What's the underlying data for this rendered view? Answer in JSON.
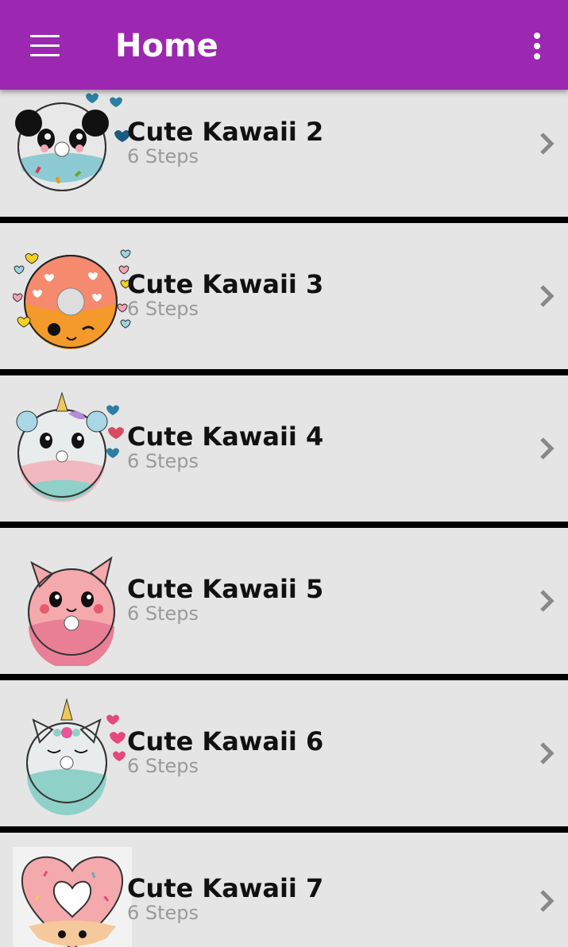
{
  "app_bar": {
    "title": "Home",
    "menu_icon": "hamburger-menu-icon",
    "overflow_icon": "more-vertical-icon",
    "background": "#9c27b0"
  },
  "items": [
    {
      "title": "Cute Kawaii 2",
      "subtitle": "6 Steps",
      "thumbnail": "panda-donut",
      "chevron": "chevron-right-icon"
    },
    {
      "title": "Cute Kawaii 3",
      "subtitle": "6 Steps",
      "thumbnail": "orange-winking-donut",
      "chevron": "chevron-right-icon"
    },
    {
      "title": "Cute Kawaii 4",
      "subtitle": "6 Steps",
      "thumbnail": "unicorn-bear-donut",
      "chevron": "chevron-right-icon"
    },
    {
      "title": "Cute Kawaii 5",
      "subtitle": "6 Steps",
      "thumbnail": "pink-cat-donut",
      "chevron": "chevron-right-icon"
    },
    {
      "title": "Cute Kawaii 6",
      "subtitle": "6 Steps",
      "thumbnail": "unicorn-cat-donut",
      "chevron": "chevron-right-icon"
    },
    {
      "title": "Cute Kawaii 7",
      "subtitle": "6 Steps",
      "thumbnail": "heart-donut",
      "chevron": "chevron-right-icon"
    }
  ]
}
